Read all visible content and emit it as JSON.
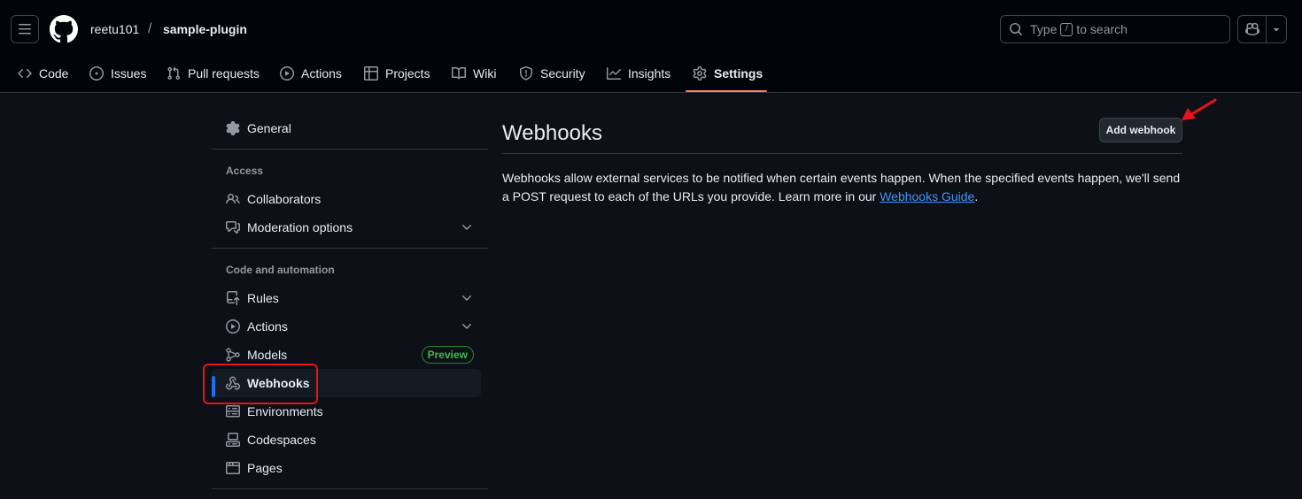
{
  "header": {
    "owner": "reetu101",
    "separator": "/",
    "repo": "sample-plugin",
    "search": {
      "before": "Type",
      "key": "/",
      "after": "to search"
    }
  },
  "repo_nav": {
    "tabs": [
      {
        "label": "Code",
        "icon": "code-icon"
      },
      {
        "label": "Issues",
        "icon": "issue-icon"
      },
      {
        "label": "Pull requests",
        "icon": "pull-request-icon"
      },
      {
        "label": "Actions",
        "icon": "play-icon"
      },
      {
        "label": "Projects",
        "icon": "table-icon"
      },
      {
        "label": "Wiki",
        "icon": "book-icon"
      },
      {
        "label": "Security",
        "icon": "shield-icon"
      },
      {
        "label": "Insights",
        "icon": "graph-icon"
      },
      {
        "label": "Settings",
        "icon": "gear-icon",
        "active": true
      }
    ]
  },
  "sidebar": {
    "general": "General",
    "groups": {
      "access": "Access",
      "code_automation": "Code and automation"
    },
    "items": {
      "collaborators": "Collaborators",
      "moderation": "Moderation options",
      "rules": "Rules",
      "actions": "Actions",
      "models": "Models",
      "models_badge": "Preview",
      "webhooks": "Webhooks",
      "environments": "Environments",
      "codespaces": "Codespaces",
      "pages": "Pages"
    },
    "selected": "Webhooks"
  },
  "main": {
    "title": "Webhooks",
    "add_button": "Add webhook",
    "description": "Webhooks allow external services to be notified when certain events happen. When the specified events happen, we'll send a POST request to each of the URLs you provide. Learn more in our ",
    "link_text": "Webhooks Guide",
    "description_end": "."
  },
  "colors": {
    "background": "#0d1117",
    "header_bg": "#010409",
    "accent_underline": "#f78166",
    "selection_bar": "#1f6feb",
    "link": "#4493f8",
    "badge_green": "#3fb950",
    "annotation_red": "#e5141a"
  }
}
